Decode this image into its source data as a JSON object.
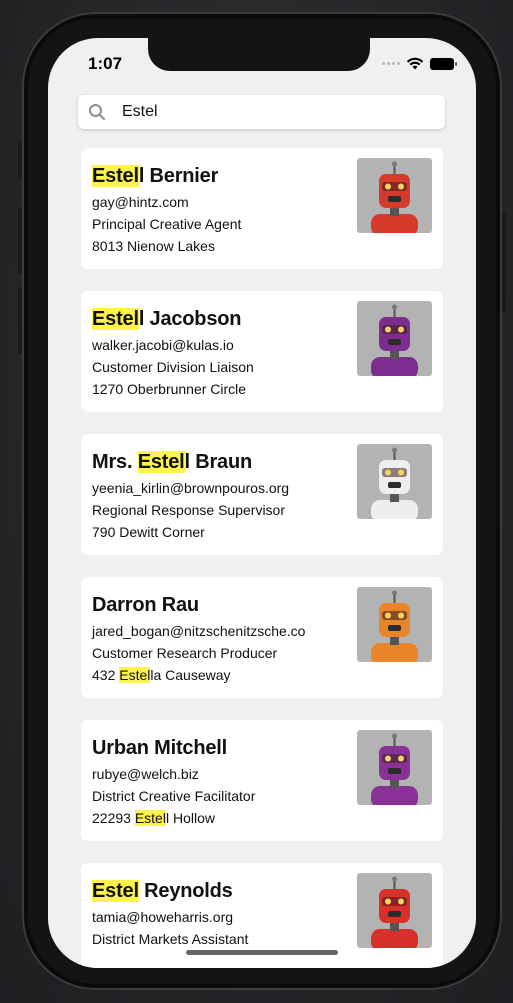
{
  "status_bar": {
    "time": "1:07"
  },
  "search": {
    "value": "Estel",
    "placeholder": ""
  },
  "contacts": [
    {
      "name": [
        "",
        "Estel",
        "l Bernier"
      ],
      "email": [
        "gay@hintz.com",
        "",
        ""
      ],
      "title": [
        "Principal Creative Agent",
        "",
        ""
      ],
      "address": [
        "8013 Nienow Lakes",
        "",
        ""
      ],
      "avatar": {
        "icon": "red-robot-icon",
        "color": "#d63a2a"
      }
    },
    {
      "name": [
        "",
        "Estel",
        "l Jacobson"
      ],
      "email": [
        "walker.jacobi@kulas.io",
        "",
        ""
      ],
      "title": [
        "Customer Division Liaison",
        "",
        ""
      ],
      "address": [
        "1270 Oberbrunner Circle",
        "",
        ""
      ],
      "avatar": {
        "icon": "purple-robot-icon",
        "color": "#7d2d8f"
      }
    },
    {
      "name": [
        "Mrs. ",
        "Estel",
        "l Braun"
      ],
      "email": [
        "yeenia_kirlin@brownpouros.org",
        "",
        ""
      ],
      "title": [
        "Regional Response Supervisor",
        "",
        ""
      ],
      "address": [
        "790 Dewitt Corner",
        "",
        ""
      ],
      "avatar": {
        "icon": "white-robot-icon",
        "color": "#eeeeee"
      }
    },
    {
      "name": [
        "Darron Rau",
        "",
        ""
      ],
      "email": [
        "jared_bogan@nitzschenitzsche.co",
        "",
        ""
      ],
      "title": [
        "Customer Research Producer",
        "",
        ""
      ],
      "address": [
        "432 ",
        "Estel",
        "la Causeway"
      ],
      "avatar": {
        "icon": "orange-robot-icon",
        "color": "#e8842a"
      }
    },
    {
      "name": [
        "Urban Mitchell",
        "",
        ""
      ],
      "email": [
        "rubye@welch.biz",
        "",
        ""
      ],
      "title": [
        "District Creative Facilitator",
        "",
        ""
      ],
      "address": [
        "22293 ",
        "Estel",
        "l Hollow"
      ],
      "avatar": {
        "icon": "purple-robot-icon",
        "color": "#8a3198"
      }
    },
    {
      "name": [
        "",
        "Estel",
        " Reynolds"
      ],
      "email": [
        "tamia@howeharris.org",
        "",
        ""
      ],
      "title": [
        "District Markets Assistant",
        "",
        ""
      ],
      "address": [
        "",
        "",
        ""
      ],
      "avatar": {
        "icon": "red-robot-icon",
        "color": "#d9302a"
      }
    }
  ]
}
